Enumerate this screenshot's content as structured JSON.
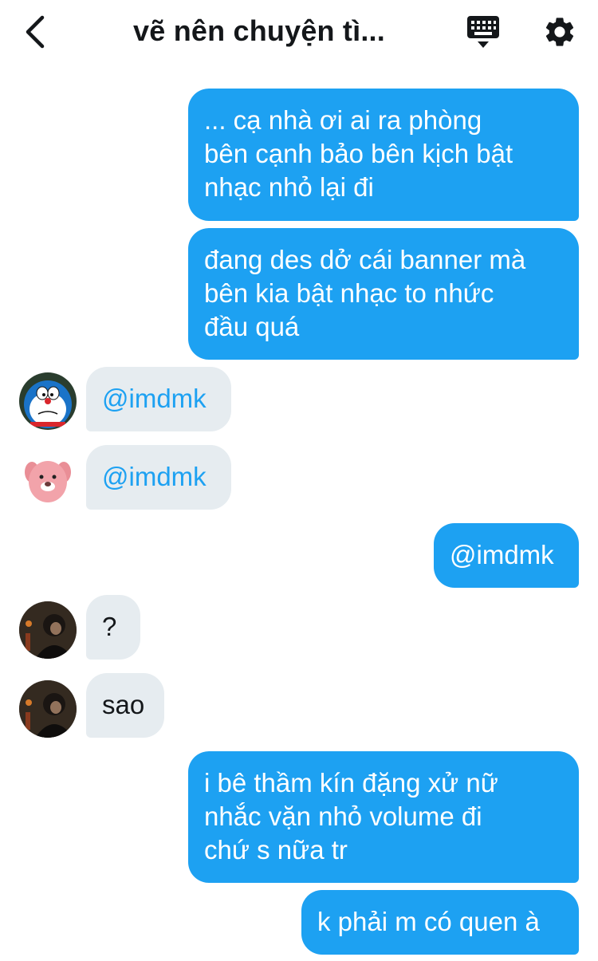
{
  "header": {
    "title": "vẽ nên chuyện tì...",
    "back_icon": "chevron-left-icon",
    "keyboard_icon": "keyboard-icon",
    "settings_icon": "gear-icon"
  },
  "colors": {
    "outgoing_bubble": "#1da1f2",
    "incoming_bubble": "#e6ecf0",
    "mention_text": "#1da1f2"
  },
  "messages": [
    {
      "direction": "outgoing",
      "lines": [
        "... cạ nhà ơi ai ra phòng",
        "bên cạnh bảo bên kịch bật",
        "nhạc nhỏ lại đi"
      ]
    },
    {
      "direction": "outgoing",
      "lines": [
        "đang des dở cái banner mà",
        "bên kia bật nhạc to nhức",
        "đầu quá"
      ]
    },
    {
      "direction": "incoming",
      "avatar": "doraemon-avatar",
      "lines": [
        "@imdmk"
      ]
    },
    {
      "direction": "incoming",
      "avatar": "pink-beaver-avatar",
      "lines": [
        "@imdmk"
      ]
    },
    {
      "direction": "outgoing",
      "lines": [
        "@imdmk"
      ]
    },
    {
      "direction": "incoming",
      "avatar": "dark-photo-avatar",
      "lines": [
        "?"
      ]
    },
    {
      "direction": "incoming",
      "avatar": "dark-photo-avatar",
      "lines": [
        "sao"
      ]
    },
    {
      "direction": "outgoing",
      "lines": [
        "i bê thầm kín đặng xử nữ",
        "nhắc vặn nhỏ volume đi",
        "chứ s nữa tr"
      ]
    },
    {
      "direction": "outgoing",
      "lines": [
        "k phải m có quen à"
      ]
    }
  ]
}
